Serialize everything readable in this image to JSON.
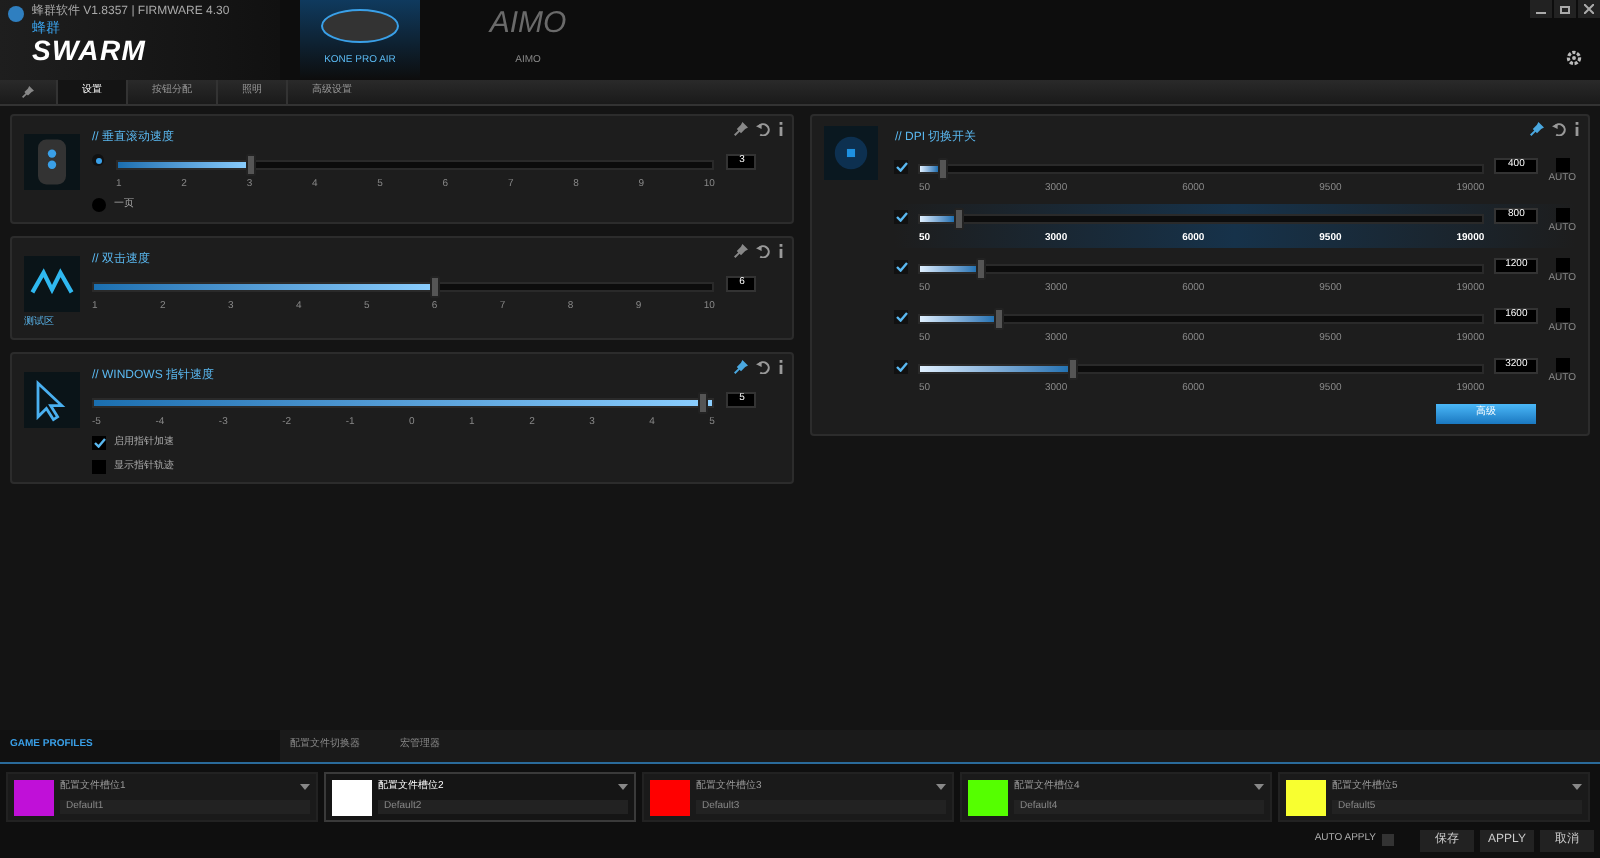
{
  "window": {
    "title": "蜂群软件 V1.8357 | FIRMWARE 4.30"
  },
  "logo": {
    "subtitle": "蜂群",
    "name": "SWARM"
  },
  "devices": [
    {
      "kind": "mouse",
      "label": "KONE PRO AIR",
      "selected": true
    },
    {
      "kind": "logo",
      "logo": "AIMO",
      "label": "AIMO",
      "selected": false
    }
  ],
  "tabs": [
    {
      "label": "设置",
      "selected": true
    },
    {
      "label": "按钮分配",
      "selected": false
    },
    {
      "label": "照明",
      "selected": false
    },
    {
      "label": "高级设置",
      "selected": false
    }
  ],
  "panels": [
    {
      "kind": "scroll",
      "title": "// 垂直滚动速度",
      "pinned": false,
      "radio_selected": true,
      "level": 0.222,
      "value": "3",
      "ticks": [
        "1",
        "2",
        "3",
        "4",
        "5",
        "6",
        "7",
        "8",
        "9",
        "10"
      ],
      "options": [
        {
          "kind": "radio",
          "label": "一页",
          "checked": false
        }
      ]
    },
    {
      "kind": "click",
      "title": "// 双击速度",
      "pinned": false,
      "caption": "测试区",
      "level": 0.556,
      "value": "6",
      "ticks": [
        "1",
        "2",
        "3",
        "4",
        "5",
        "6",
        "7",
        "8",
        "9",
        "10"
      ]
    },
    {
      "kind": "pointer",
      "title": "// WINDOWS 指针速度",
      "pinned": true,
      "level": 1,
      "value": "5",
      "ticks": [
        "-5",
        "-4",
        "-3",
        "-2",
        "-1",
        "0",
        "1",
        "2",
        "3",
        "4",
        "5"
      ],
      "options": [
        {
          "kind": "checkbox",
          "label": "启用指针加速",
          "checked": true
        },
        {
          "kind": "checkbox",
          "label": "显示指针轨迹",
          "checked": false
        }
      ]
    }
  ],
  "dpi": {
    "title": "// DPI 切换开关",
    "pinned": true,
    "button": "高级",
    "rows": [
      {
        "checked": true,
        "level": 0.03,
        "ticks": [
          "50",
          "3000",
          "6000",
          "9500",
          "19000"
        ],
        "value": "400",
        "auto": false,
        "auto_label": "AUTO",
        "selected": false
      },
      {
        "checked": true,
        "level": 0.06,
        "ticks": [
          "50",
          "3000",
          "6000",
          "9500",
          "19000"
        ],
        "value": "800",
        "auto": false,
        "auto_label": "AUTO",
        "selected": true
      },
      {
        "checked": true,
        "level": 0.1,
        "ticks": [
          "50",
          "3000",
          "6000",
          "9500",
          "19000"
        ],
        "value": "1200",
        "auto": false,
        "auto_label": "AUTO",
        "selected": false
      },
      {
        "checked": true,
        "level": 0.135,
        "ticks": [
          "50",
          "3000",
          "6000",
          "9500",
          "19000"
        ],
        "value": "1600",
        "auto": false,
        "auto_label": "AUTO",
        "selected": false
      },
      {
        "checked": true,
        "level": 0.27,
        "ticks": [
          "50",
          "3000",
          "6000",
          "9500",
          "19000"
        ],
        "value": "3200",
        "auto": false,
        "auto_label": "AUTO",
        "selected": false
      }
    ]
  },
  "profile_tabs": [
    {
      "label": "GAME PROFILES",
      "selected": true
    },
    {
      "label": "配置文件切换器",
      "selected": false
    },
    {
      "label": "宏管理器",
      "selected": false
    }
  ],
  "profiles": [
    {
      "name": "配置文件槽位1",
      "default": "Default1",
      "color": "#c010d8",
      "selected": false
    },
    {
      "name": "配置文件槽位2",
      "default": "Default2",
      "color": "#ffffff",
      "selected": true
    },
    {
      "name": "配置文件槽位3",
      "default": "Default3",
      "color": "#ff0000",
      "selected": false
    },
    {
      "name": "配置文件槽位4",
      "default": "Default4",
      "color": "#55ff00",
      "selected": false
    },
    {
      "name": "配置文件槽位5",
      "default": "Default5",
      "color": "#f8ff30",
      "selected": false
    }
  ],
  "footer": {
    "auto_apply": {
      "label": "AUTO APPLY",
      "checked": false
    },
    "buttons": [
      "保存",
      "APPLY",
      "取消"
    ]
  }
}
